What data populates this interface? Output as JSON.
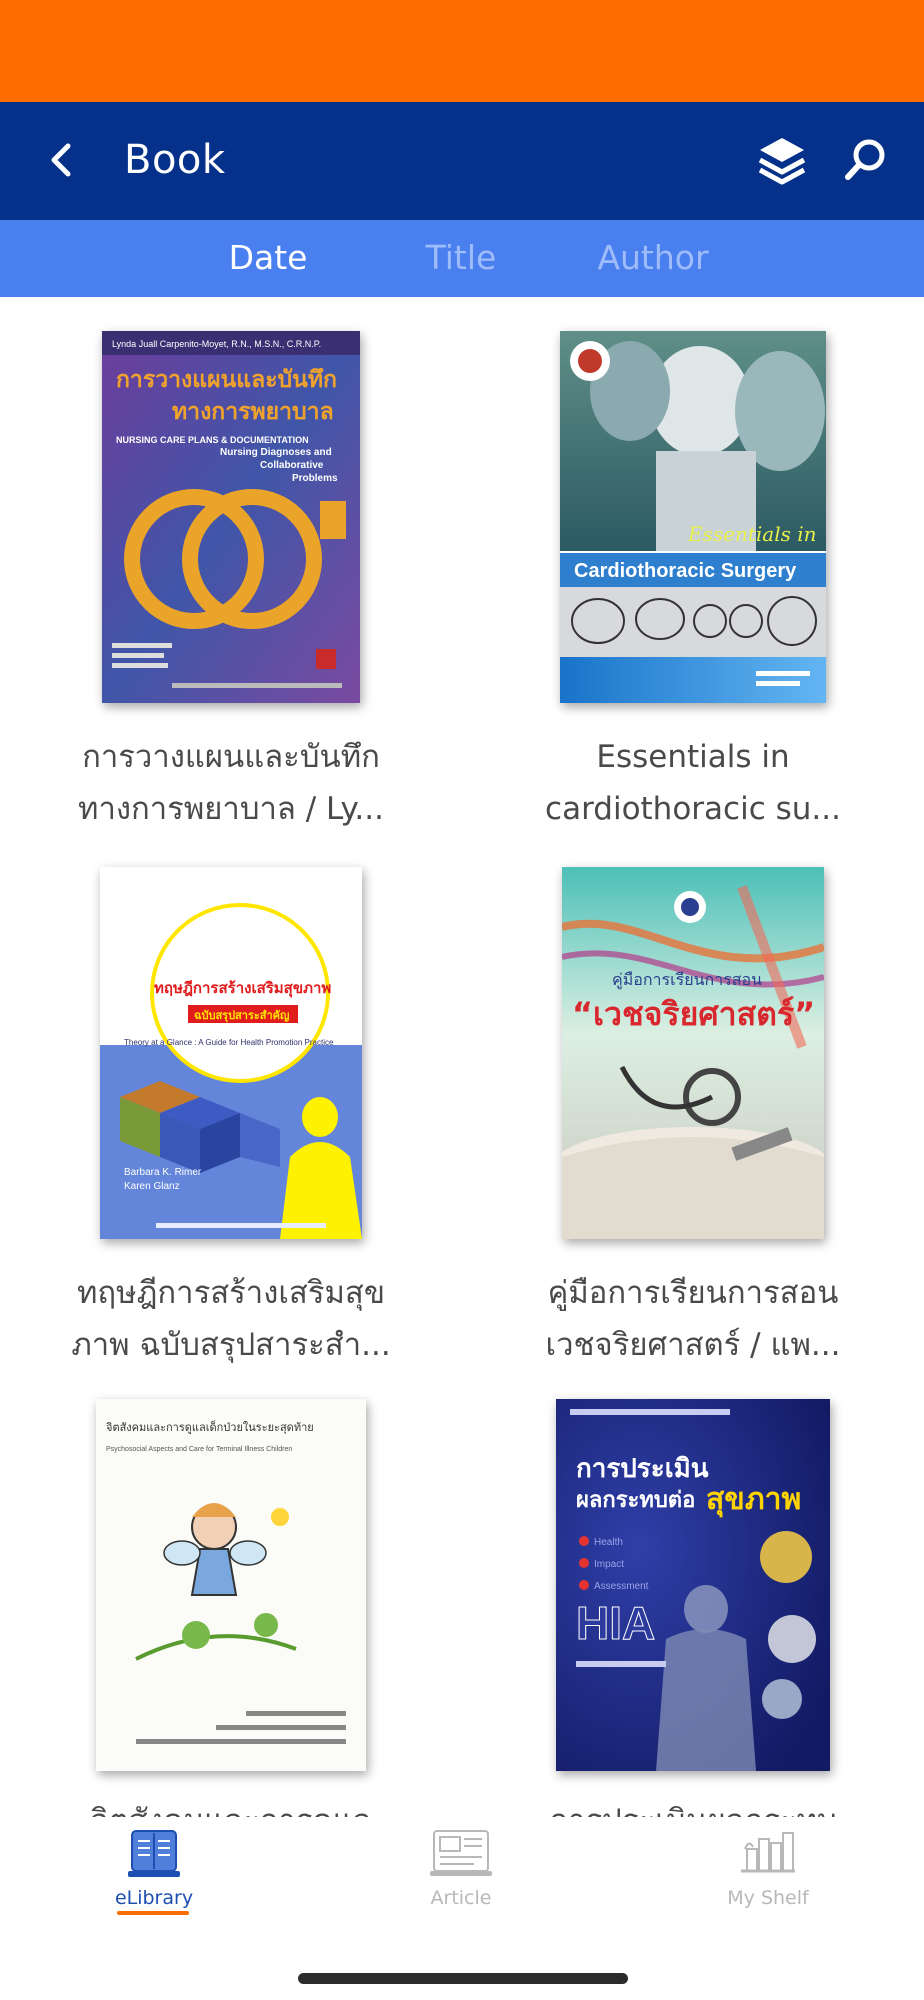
{
  "app_bar": {
    "title": "Book",
    "back_icon": "chevron-left-icon",
    "layers_icon": "layers-icon",
    "search_icon": "search-icon",
    "background": "#06318a"
  },
  "status_bar": {
    "background": "#ff6d00"
  },
  "sort_tabs": {
    "selected": "Date",
    "items": [
      {
        "label": "Date"
      },
      {
        "label": "Title"
      },
      {
        "label": "Author"
      }
    ]
  },
  "books": [
    {
      "line1": "การวางแผนและบันทึก",
      "line2": "ทางการพยาบาล / Ly...",
      "cover_text": [
        "Lynda Juall Carpenito-Moyet, R.N., M.S.N., C.R.N.P.",
        "การวางแผนและบันทึก",
        "ทางการพยาบาล",
        "NURSING CARE PLANS & DOCUMENTATION",
        "Nursing Diagnoses and",
        "Collaborative",
        "Problems"
      ]
    },
    {
      "line1": "Essentials in",
      "line2": "cardiothoracic su...",
      "cover_text": [
        "Essentials in",
        "Cardiothoracic Surgery"
      ]
    },
    {
      "line1": "ทฤษฎีการสร้างเสริมสุข",
      "line2": "ภาพ ฉบับสรุปสาระสำ...",
      "cover_text": [
        "ทฤษฎีการสร้างเสริมสุขภาพ",
        "ฉบับสรุปสาระสำคัญ",
        "Theory at a Glance : A Guide for Health Promotion Practice",
        "Barbara K. Rimer",
        "Karen Glanz"
      ]
    },
    {
      "line1": "คู่มือการเรียนการสอน",
      "line2": "เวชจริยศาสตร์ / แพ...",
      "cover_text": [
        "คู่มือการเรียนการสอน",
        "“เวชจริยศาสตร์”"
      ]
    },
    {
      "line1": "จิตสังคมและการดูแล",
      "line2": "",
      "cover_text": [
        "จิตสังคมและการดูแลเด็กป่วยในระยะสุดท้าย",
        "Psychosocial Aspects and Care for Terminal Illness Children"
      ]
    },
    {
      "line1": "การประเมินผลกระทบ",
      "line2": "",
      "cover_text": [
        "การประเมิน",
        "ผลกระทบต่อ",
        "สุขภาพ",
        "Health",
        "Impact",
        "Assessment",
        "HIA"
      ]
    }
  ],
  "bottom_nav": {
    "items": [
      {
        "label": "eLibrary",
        "icon": "library-book-icon",
        "active": true
      },
      {
        "label": "Article",
        "icon": "article-icon",
        "active": false
      },
      {
        "label": "My Shelf",
        "icon": "bookshelf-icon",
        "active": false
      }
    ],
    "active_color": "#1d4fb3",
    "accent": "#ff6d00"
  }
}
